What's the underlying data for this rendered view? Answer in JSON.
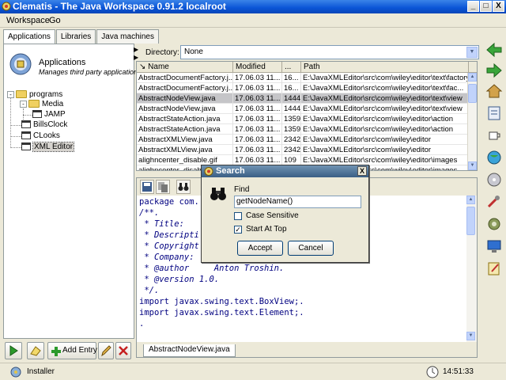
{
  "window": {
    "title": "Clematis - The Java Workspace 0.91.2 localroot",
    "minimize": "_",
    "maximize": "□",
    "close": "X"
  },
  "menu": [
    "Workspace",
    "Go"
  ],
  "tabs": [
    "Applications",
    "Libraries",
    "Java machines"
  ],
  "left_panel": {
    "header_title": "Applications",
    "header_subtitle": "Manages third party applications",
    "tree": {
      "root": "programs",
      "media": "Media",
      "jamp": "JAMP",
      "billsclock": "BillsClock",
      "clooks": "CLooks",
      "xml_editor": "XML Editor"
    },
    "add_entry": "Add Entry"
  },
  "directory": {
    "label": "Directory:",
    "value": "None"
  },
  "table": {
    "columns": [
      "Name",
      "Modified",
      "...",
      "Path"
    ],
    "rows": [
      [
        "AbstractDocumentFactory.j...",
        "17.06.03 11...",
        "16...",
        "E:\\JavaXMLEditor\\src\\com\\wiley\\editor\\text\\factory"
      ],
      [
        "AbstractDocumentFactory.j...",
        "17.06.03 11...",
        "16...",
        "E:\\JavaXMLEditor\\src\\com\\wiley\\editor\\text\\fac..."
      ],
      [
        "AbstractNodeView.java",
        "17.06.03 11...",
        "1444",
        "E:\\JavaXMLEditor\\src\\com\\wiley\\editor\\text\\view"
      ],
      [
        "AbstractNodeView.java",
        "17.06.03 11...",
        "1444",
        "E:\\JavaXMLEditor\\src\\com\\wiley\\editor\\text\\view"
      ],
      [
        "AbstractStateAction.java",
        "17.06.03 11...",
        "1359",
        "E:\\JavaXMLEditor\\src\\com\\wiley\\editor\\action"
      ],
      [
        "AbstractStateAction.java",
        "17.06.03 11...",
        "1359",
        "E:\\JavaXMLEditor\\src\\com\\wiley\\editor\\action"
      ],
      [
        "AbstractXMLView.java",
        "17.06.03 11...",
        "2342",
        "E:\\JavaXMLEditor\\src\\com\\wiley\\editor"
      ],
      [
        "AbstractXMLView.java",
        "17.06.03 11...",
        "2342",
        "E:\\JavaXMLEditor\\src\\com\\wiley\\editor"
      ],
      [
        "alighncenter_disable.gif",
        "17.06.03 11...",
        "109",
        "E:\\JavaXMLEditor\\src\\com\\wiley\\editor\\images"
      ],
      [
        "alighncenter_disable...",
        "17.06.03 11...",
        "109",
        "E:\\JavaXMLEditor\\src\\com\\wiley\\editor\\images"
      ]
    ],
    "selected_index": 2
  },
  "editor": {
    "lines": [
      "package com.",
      "/**.",
      " * Title:",
      " * Descripti",
      " * Copyright",
      " * Company:",
      " * @author     Anton Troshin.",
      " * @version 1.0.",
      " */.",
      "import javax.swing.text.BoxView;.",
      "import javax.swing.text.Element;.",
      "."
    ],
    "tab_label": "AbstractNodeView.java"
  },
  "dialog": {
    "title": "Search",
    "close": "X",
    "find_label": "Find",
    "find_value": "getNodeName()",
    "case_sensitive_label": "Case Sensitive",
    "case_sensitive_checked": false,
    "start_at_top_label": "Start At Top",
    "start_at_top_checked": true,
    "accept": "Accept",
    "cancel": "Cancel",
    "check_mark": "✓"
  },
  "status": {
    "text": "Installer",
    "time": "14:51:33"
  }
}
